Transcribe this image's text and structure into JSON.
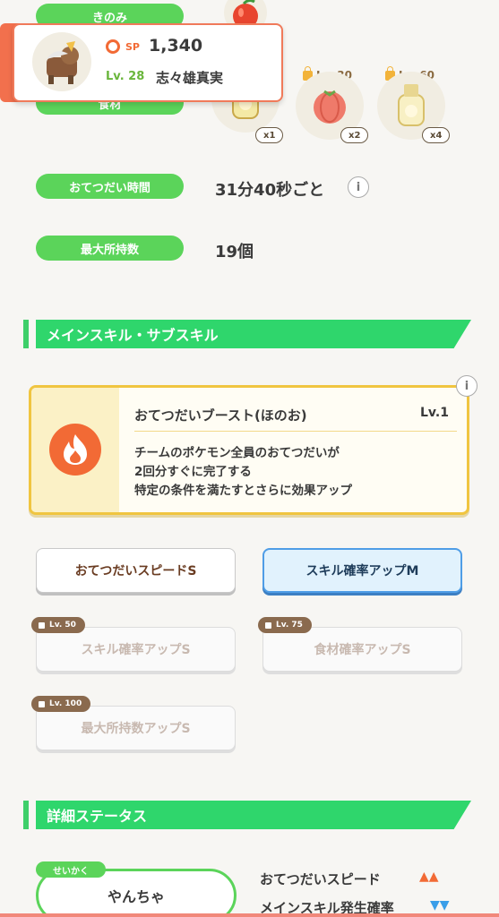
{
  "colors": {
    "accent_green": "#5bd45a",
    "section_green": "#2fd66c",
    "skill_border": "#f0c540",
    "fire": "#f26a35",
    "selected_blue": "#4f9de6"
  },
  "top_labels": {
    "berry": "きのみ",
    "ingredient": "食材"
  },
  "pokemon_card": {
    "sp_label": "SP",
    "sp_value": "1,340",
    "level": "Lv. 28",
    "nickname": "志々雄真実",
    "sprite_icon": "entei-sprite-icon"
  },
  "ingredients": [
    {
      "name": "honey-icon",
      "quantity": "x1",
      "unlock": ""
    },
    {
      "name": "tomato-icon",
      "quantity": "x2",
      "unlock": "Lv. 30"
    },
    {
      "name": "honey-icon",
      "quantity": "x4",
      "unlock": "Lv. 60"
    }
  ],
  "stats": [
    {
      "label": "おてつだい時間",
      "value": "31分40秒ごと"
    },
    {
      "label": "最大所持数",
      "value": "19個"
    }
  ],
  "sections": {
    "skills": "メインスキル・サブスキル",
    "details": "詳細ステータス"
  },
  "main_skill": {
    "name": "おてつだいブースト(ほのお)",
    "level": "Lv.1",
    "desc_line1": "チームのポケモン全員のおてつだいが",
    "desc_line2": "2回分すぐに完了する",
    "desc_line3": "特定の条件を満たすとさらに効果アップ",
    "icon": "fire-icon"
  },
  "sub_skills": [
    {
      "label": "おてつだいスピードS",
      "unlock": "",
      "state": "active"
    },
    {
      "label": "スキル確率アップM",
      "unlock": "",
      "state": "selected"
    },
    {
      "label": "スキル確率アップS",
      "unlock": "Lv. 50",
      "state": "locked"
    },
    {
      "label": "食材確率アップS",
      "unlock": "Lv. 75",
      "state": "locked"
    },
    {
      "label": "最大所持数アップS",
      "unlock": "Lv. 100",
      "state": "locked"
    }
  ],
  "nature": {
    "tag": "せいかく",
    "value": "やんちゃ"
  },
  "nature_effects": [
    {
      "label": "おてつだいスピード",
      "indicator": "▲▲"
    },
    {
      "label": "メインスキル発生確率",
      "indicator": "▼▼"
    }
  ],
  "info_icon": "i"
}
